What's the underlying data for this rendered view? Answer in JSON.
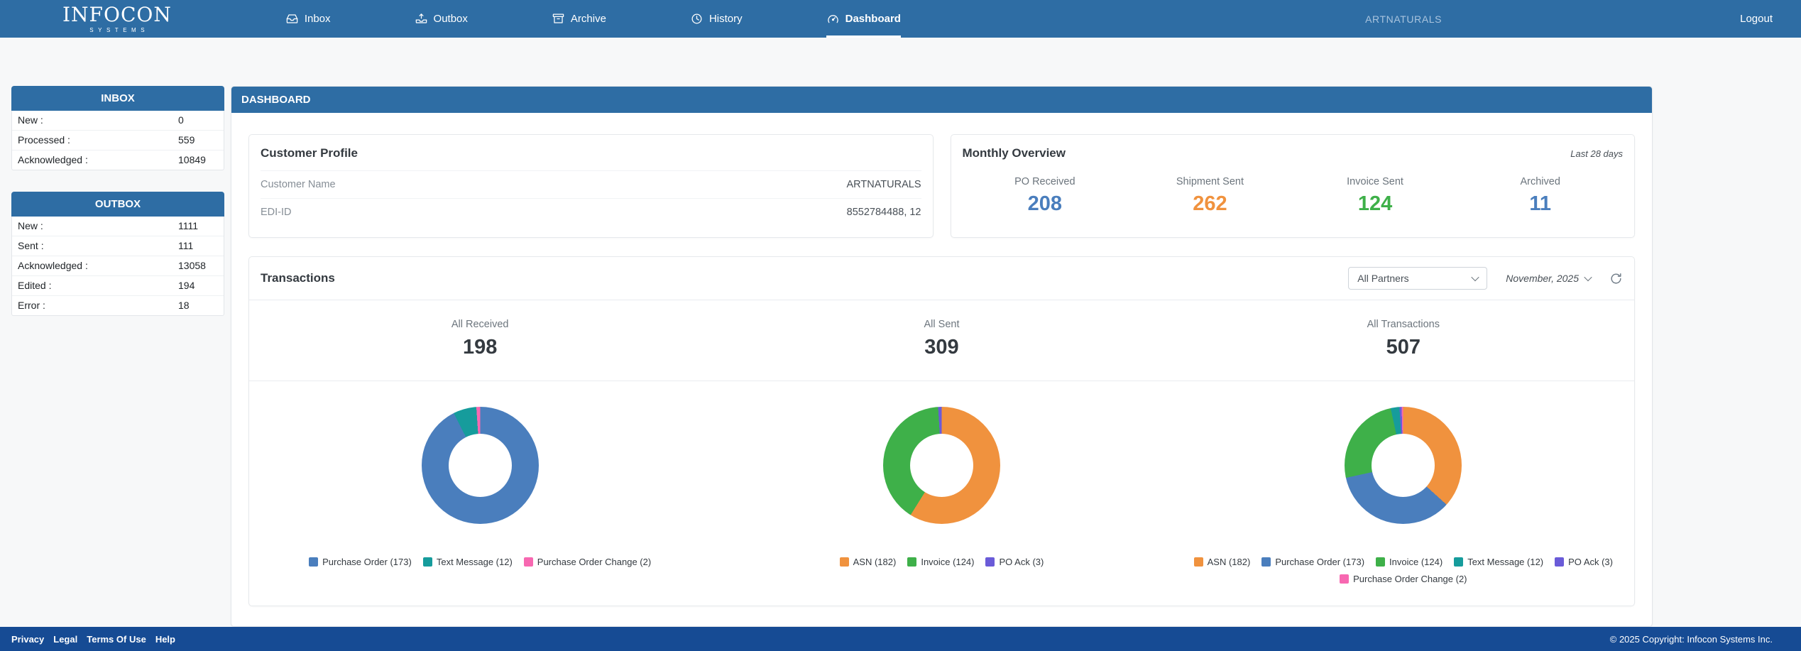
{
  "brand": {
    "name": "INFOCON",
    "subname": "SYSTEMS"
  },
  "nav": {
    "items": [
      {
        "label": "Inbox",
        "icon": "inbox-icon",
        "active": false
      },
      {
        "label": "Outbox",
        "icon": "outbox-icon",
        "active": false
      },
      {
        "label": "Archive",
        "icon": "archive-icon",
        "active": false
      },
      {
        "label": "History",
        "icon": "history-icon",
        "active": false
      },
      {
        "label": "Dashboard",
        "icon": "dashboard-icon",
        "active": true
      }
    ],
    "account": "ARTNATURALS",
    "logout_label": "Logout"
  },
  "sidebar": {
    "inbox": {
      "title": "INBOX",
      "rows": [
        {
          "label": "New :",
          "value": "0"
        },
        {
          "label": "Processed :",
          "value": "559"
        },
        {
          "label": "Acknowledged :",
          "value": "10849"
        }
      ]
    },
    "outbox": {
      "title": "OUTBOX",
      "rows": [
        {
          "label": "New :",
          "value": "1111"
        },
        {
          "label": "Sent :",
          "value": "111"
        },
        {
          "label": "Acknowledged :",
          "value": "13058"
        },
        {
          "label": "Edited :",
          "value": "194"
        },
        {
          "label": "Error :",
          "value": "18"
        }
      ]
    }
  },
  "main": {
    "page_title": "DASHBOARD",
    "customer_profile": {
      "title": "Customer Profile",
      "rows": [
        {
          "label": "Customer Name",
          "value": "ARTNATURALS"
        },
        {
          "label": "EDI-ID",
          "value": "8552784488, 12"
        }
      ]
    },
    "monthly_overview": {
      "title": "Monthly Overview",
      "period": "Last 28 days",
      "stats": [
        {
          "label": "PO Received",
          "value": "208",
          "color": "#4a7ebd"
        },
        {
          "label": "Shipment Sent",
          "value": "262",
          "color": "#f0923e"
        },
        {
          "label": "Invoice Sent",
          "value": "124",
          "color": "#3eb049"
        },
        {
          "label": "Archived",
          "value": "11",
          "color": "#4a7ebd"
        }
      ]
    },
    "transactions": {
      "title": "Transactions",
      "partner_filter": "All Partners",
      "month_filter": "November, 2025"
    }
  },
  "chart_data": [
    {
      "type": "pie",
      "title": "All Received",
      "total": "198",
      "legend_position": "bottom",
      "series": [
        {
          "name": "Purchase Order",
          "value": 173,
          "color": "#4a7ebd"
        },
        {
          "name": "Text Message",
          "value": 12,
          "color": "#169c9c"
        },
        {
          "name": "Purchase Order Change",
          "value": 2,
          "color": "#f768b1"
        }
      ]
    },
    {
      "type": "pie",
      "title": "All Sent",
      "total": "309",
      "legend_position": "bottom",
      "series": [
        {
          "name": "ASN",
          "value": 182,
          "color": "#f0923e"
        },
        {
          "name": "Invoice",
          "value": 124,
          "color": "#3eb049"
        },
        {
          "name": "PO Ack",
          "value": 3,
          "color": "#6a5bd8"
        }
      ]
    },
    {
      "type": "pie",
      "title": "All Transactions",
      "total": "507",
      "legend_position": "bottom",
      "series": [
        {
          "name": "ASN",
          "value": 182,
          "color": "#f0923e"
        },
        {
          "name": "Purchase Order",
          "value": 173,
          "color": "#4a7ebd"
        },
        {
          "name": "Invoice",
          "value": 124,
          "color": "#3eb049"
        },
        {
          "name": "Text Message",
          "value": 12,
          "color": "#169c9c"
        },
        {
          "name": "PO Ack",
          "value": 3,
          "color": "#6a5bd8"
        },
        {
          "name": "Purchase Order Change",
          "value": 2,
          "color": "#f768b1"
        }
      ]
    }
  ],
  "footer": {
    "links": [
      "Privacy",
      "Legal",
      "Terms Of Use",
      "Help"
    ],
    "copyright": "© 2025 Copyright: Infocon Systems Inc."
  }
}
